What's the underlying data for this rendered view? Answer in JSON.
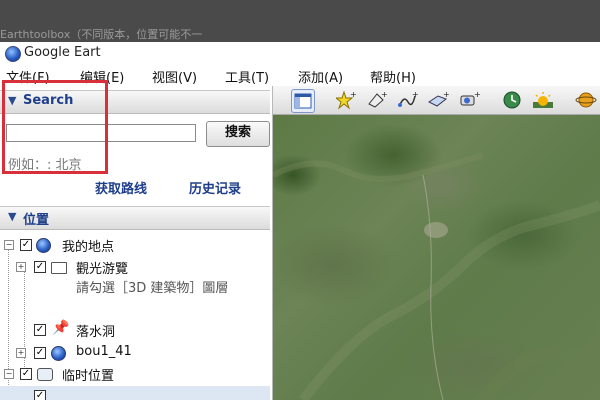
{
  "background": {
    "text": "Earthtoolbox（不同版本，位置可能不一"
  },
  "window": {
    "title": "Google Eart"
  },
  "menu": [
    {
      "label": "文件(F)"
    },
    {
      "label": "编辑(E)"
    },
    {
      "label": "视图(V)"
    },
    {
      "label": "工具(T)"
    },
    {
      "label": "添加(A)"
    },
    {
      "label": "帮助(H)"
    }
  ],
  "search_panel": {
    "header": "Search",
    "input_value": "",
    "button_label": "搜索",
    "example": "例如：: 北京",
    "directions_link": "获取路线",
    "history_link": "历史记录"
  },
  "places_panel": {
    "header": "位置",
    "items": [
      {
        "label": "我的地点",
        "icon": "globe-icon"
      },
      {
        "label": "觀光游覽",
        "icon": "folder-icon"
      },
      {
        "description": "請勾選［3D 建築物］圖層"
      },
      {
        "label": "落水洞",
        "icon": "placemark-pin-icon"
      },
      {
        "label": "bou1_41",
        "icon": "globe-icon"
      },
      {
        "label": "临时位置",
        "icon": "temporary-places-icon"
      }
    ]
  },
  "toolbar": {
    "buttons": [
      {
        "icon": "sidebar-toggle-icon"
      },
      {
        "icon": "add-placemark-icon"
      },
      {
        "icon": "add-polygon-icon"
      },
      {
        "icon": "add-path-icon"
      },
      {
        "icon": "add-image-overlay-icon"
      },
      {
        "icon": "record-tour-icon"
      },
      {
        "icon": "historical-imagery-icon"
      },
      {
        "icon": "sunlight-icon"
      },
      {
        "icon": "planet-switch-icon"
      }
    ]
  },
  "colors": {
    "link": "#1f3f8a",
    "highlight_box": "#d8303a"
  }
}
